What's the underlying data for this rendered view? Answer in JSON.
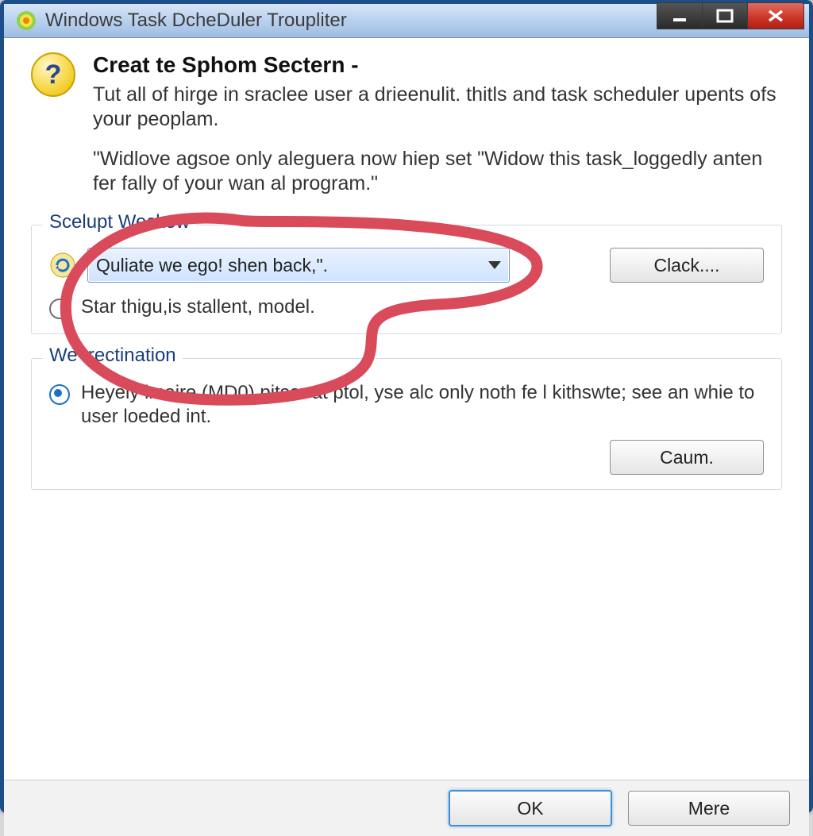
{
  "window": {
    "title": "Windows Task DcheDuler Troupliter"
  },
  "header": {
    "heading": "Creat te Sphom Sectern -",
    "desc1": "Tut all of hirge in sraclee user a drieenulit. thitls and task scheduler upents ofs your peoplam.",
    "desc2": "\"Widlove agsoe only aleguera now hiep set \"Widow this task_loggedly anten fer fally of your wan al program.\""
  },
  "group1": {
    "legend": "Scelupt Weckow",
    "combo_value": "Quliate we ego! shen back,\".",
    "button": "Clack....",
    "radio_label": "Star thigu,is stallent, model."
  },
  "group2": {
    "legend": "We trectination",
    "radio_label": "Heyely imaire (MD0) pitser at ptol, yse alc only noth fe l kithswte; see an whie to user loeded int.",
    "button": "Caum."
  },
  "footer": {
    "ok": "OK",
    "more": "Mere"
  }
}
